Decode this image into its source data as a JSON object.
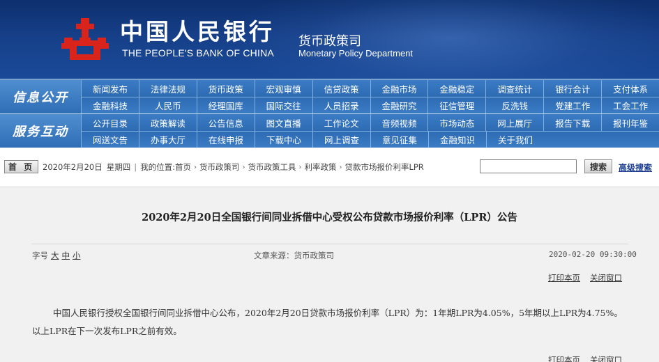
{
  "header": {
    "cn_name": "中国人民银行",
    "en_name": "THE PEOPLE'S BANK OF CHINA",
    "dept_cn": "货币政策司",
    "dept_en": "Monetary Policy Department",
    "logo_icon": "pboc-logo-icon",
    "logo_color": "#d9241c"
  },
  "nav": {
    "sections": [
      {
        "label": "信息公开",
        "rows": [
          [
            "新闻发布",
            "法律法规",
            "货币政策",
            "宏观审慎",
            "信贷政策",
            "金融市场",
            "金融稳定",
            "调查统计",
            "银行会计",
            "支付体系"
          ],
          [
            "金融科技",
            "人民币",
            "经理国库",
            "国际交往",
            "人员招录",
            "金融研究",
            "征信管理",
            "反洗钱",
            "党建工作",
            "工会工作"
          ]
        ]
      },
      {
        "label": "服务互动",
        "rows": [
          [
            "公开目录",
            "政策解读",
            "公告信息",
            "图文直播",
            "工作论文",
            "音频视频",
            "市场动态",
            "网上展厅",
            "报告下载",
            "报刊年鉴"
          ],
          [
            "网送文告",
            "办事大厅",
            "在线申报",
            "下载中心",
            "网上调查",
            "意见征集",
            "金融知识",
            "关于我们"
          ]
        ]
      }
    ]
  },
  "breadcrumb": {
    "home_label": "首 页",
    "date": "2020年2月20日",
    "weekday": "星期四",
    "location_label": "我的位置:",
    "path": [
      "首页",
      "货币政策司",
      "货币政策工具",
      "利率政策",
      "贷款市场报价利率LPR"
    ],
    "search_placeholder": "",
    "search_button": "搜索",
    "advanced_search": "高级搜索"
  },
  "article": {
    "title": "2020年2月20日全国银行间同业拆借中心受权公布贷款市场报价利率（LPR）公告",
    "font_size_label": "字号",
    "font_sizes": [
      "大",
      "中",
      "小"
    ],
    "source": "文章来源：货币政策司",
    "datetime": "2020-02-20  09:30:00",
    "print_label": "打印本页",
    "close_label": "关闭窗口",
    "body": "中国人民银行授权全国银行间同业拆借中心公布，2020年2月20日贷款市场报价利率（LPR）为：1年期LPR为4.05%，5年期以上LPR为4.75%。以上LPR在下一次发布LPR之前有效。"
  }
}
